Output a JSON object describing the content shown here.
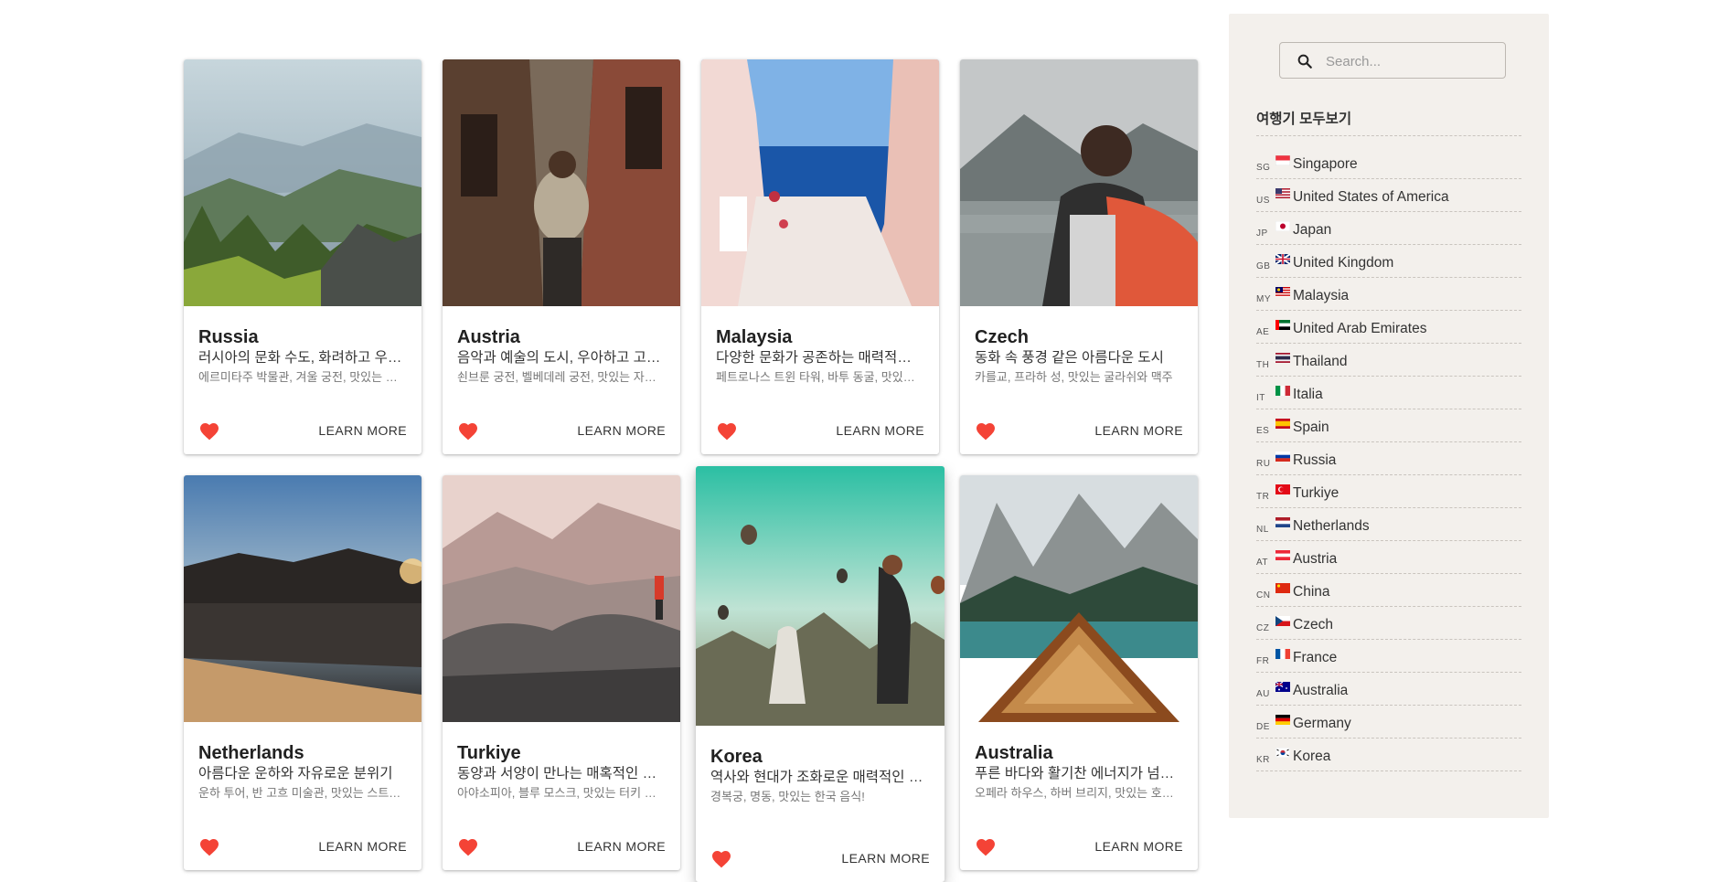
{
  "cards": [
    {
      "title": "Russia",
      "subtitle": "러시아의 문화 수도, 화려하고 우아한 도시",
      "desc": "에르미타주 박물관, 겨울 궁전, 맛있는 러시아 음식",
      "learn": "LEARN MORE"
    },
    {
      "title": "Austria",
      "subtitle": "음악과 예술의 도시, 우아하고 고풍스러운",
      "desc": "쇤브룬 궁전, 벨베데레 궁전, 맛있는 자허토르테",
      "learn": "LEARN MORE"
    },
    {
      "title": "Malaysia",
      "subtitle": "다양한 문화가 공존하는 매력적인 나라",
      "desc": "페트로나스 트윈 타워, 바투 동굴, 맛있는 나시르막",
      "learn": "LEARN MORE"
    },
    {
      "title": "Czech",
      "subtitle": "동화 속 풍경 같은 아름다운 도시",
      "desc": "카를교, 프라하 성, 맛있는 굴라쉬와 맥주",
      "learn": "LEARN MORE"
    },
    {
      "title": "Netherlands",
      "subtitle": "아름다운 운하와 자유로운 분위기",
      "desc": "운하 투어, 반 고흐 미술관, 맛있는 스트룹와플",
      "learn": "LEARN MORE"
    },
    {
      "title": "Turkiye",
      "subtitle": "동양과 서양이 만나는 매혹적인 나라",
      "desc": "아야소피아, 블루 모스크, 맛있는 터키 음식",
      "learn": "LEARN MORE"
    },
    {
      "title": "Korea",
      "subtitle": "역사와 현대가 조화로운 매력적인 나라",
      "desc": "경복궁, 명동, 맛있는 한국 음식!",
      "learn": "LEARN MORE"
    },
    {
      "title": "Australia",
      "subtitle": "푸른 바다와 활기찬 에너지가 넘치는 나라",
      "desc": "오페라 하우스, 하버 브리지, 맛있는 호주 음식",
      "learn": "LEARN MORE"
    }
  ],
  "sidebar": {
    "search_placeholder": "Search...",
    "title": "여행기 모두보기",
    "countries": [
      {
        "code": "SG",
        "name": "Singapore"
      },
      {
        "code": "US",
        "name": "United States of America"
      },
      {
        "code": "JP",
        "name": "Japan"
      },
      {
        "code": "GB",
        "name": "United Kingdom"
      },
      {
        "code": "MY",
        "name": "Malaysia"
      },
      {
        "code": "AE",
        "name": "United Arab Emirates"
      },
      {
        "code": "TH",
        "name": "Thailand"
      },
      {
        "code": "IT",
        "name": "Italia"
      },
      {
        "code": "ES",
        "name": "Spain"
      },
      {
        "code": "RU",
        "name": "Russia"
      },
      {
        "code": "TR",
        "name": "Turkiye"
      },
      {
        "code": "NL",
        "name": "Netherlands"
      },
      {
        "code": "AT",
        "name": "Austria"
      },
      {
        "code": "CN",
        "name": "China"
      },
      {
        "code": "CZ",
        "name": "Czech"
      },
      {
        "code": "FR",
        "name": "France"
      },
      {
        "code": "AU",
        "name": "Australia"
      },
      {
        "code": "DE",
        "name": "Germany"
      },
      {
        "code": "KR",
        "name": "Korea"
      }
    ]
  },
  "colors": {
    "heart": "#f44336",
    "sidebar_bg": "#f3f0ec"
  }
}
